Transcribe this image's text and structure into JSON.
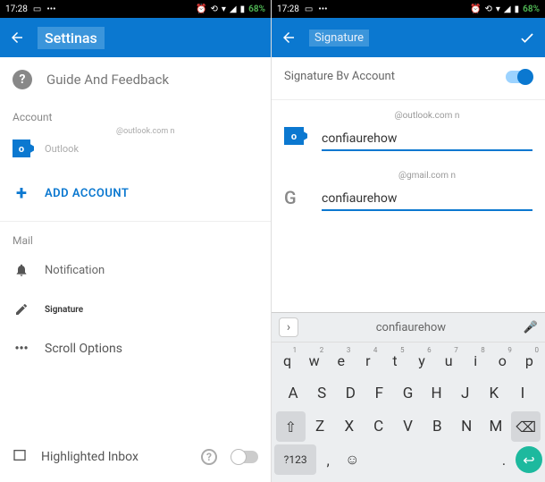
{
  "status": {
    "time": "17:28",
    "battery": "68%"
  },
  "left": {
    "title": "Settinas",
    "guide_label": "Guide And Feedback",
    "section_account": "Account",
    "outlook_label": "Outlook",
    "outlook_email": "@outlook.com n",
    "add_account": "ADD ACCOUNT",
    "section_mail": "Mail",
    "notification": "Notification",
    "signature": "Signature",
    "scroll_options": "Scroll Options",
    "highlighted_inbox": "Highlighted Inbox"
  },
  "right": {
    "title": "Signature",
    "by_account": "Signature Bv Account",
    "accounts": [
      {
        "email": "@outlook.com n",
        "signature": "confiaurehow"
      },
      {
        "email": "@gmail.com n",
        "signature": "confiaurehow"
      }
    ]
  },
  "keyboard": {
    "suggestion": "confiaurehow",
    "row1": [
      {
        "k": "q",
        "n": "1"
      },
      {
        "k": "w",
        "n": "2"
      },
      {
        "k": "e",
        "n": "3"
      },
      {
        "k": "r",
        "n": "4"
      },
      {
        "k": "t",
        "n": "5"
      },
      {
        "k": "y",
        "n": "6"
      },
      {
        "k": "u",
        "n": "7"
      },
      {
        "k": "i",
        "n": "8"
      },
      {
        "k": "o",
        "n": "9"
      },
      {
        "k": "p",
        "n": "0"
      }
    ],
    "row2": [
      "A",
      "S",
      "D",
      "F",
      "G",
      "H",
      "J",
      "K",
      "I"
    ],
    "row3": [
      "Z",
      "X",
      "C",
      "V",
      "B",
      "N",
      "M"
    ],
    "sym": "?123"
  }
}
